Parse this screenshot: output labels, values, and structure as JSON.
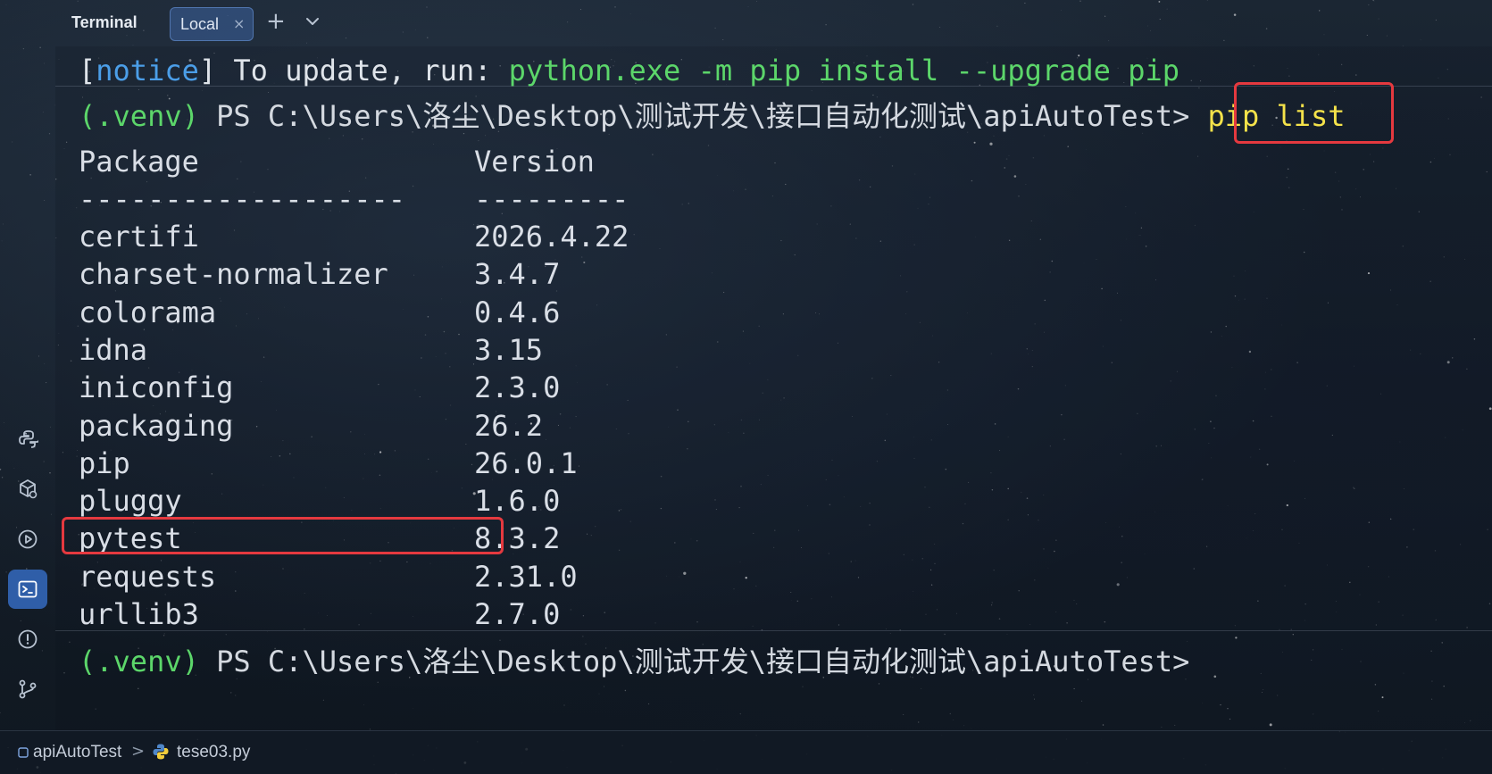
{
  "header": {
    "title": "Terminal",
    "tabs": [
      {
        "label": "Local",
        "close": "×"
      }
    ],
    "add_tab": "+"
  },
  "terminal": {
    "notice": {
      "bracket_open": "[",
      "tag": "notice",
      "bracket_close": "]",
      "text": " To update, run: ",
      "command": "python.exe -m pip install --upgrade pip"
    },
    "command_line": {
      "venv": "(.venv)",
      "prompt": " PS C:\\Users\\洛尘\\Desktop\\测试开发\\接口自动化测试\\apiAutoTest>",
      "command": "pip list"
    },
    "table": {
      "headers": {
        "package": "Package",
        "version": "Version"
      },
      "separators": {
        "package": "-------------------",
        "version": "---------"
      },
      "rows": [
        {
          "package": "certifi",
          "version": "2026.4.22"
        },
        {
          "package": "charset-normalizer",
          "version": "3.4.7"
        },
        {
          "package": "colorama",
          "version": "0.4.6"
        },
        {
          "package": "idna",
          "version": "3.15"
        },
        {
          "package": "iniconfig",
          "version": "2.3.0"
        },
        {
          "package": "packaging",
          "version": "26.2"
        },
        {
          "package": "pip",
          "version": "26.0.1"
        },
        {
          "package": "pluggy",
          "version": "1.6.0"
        },
        {
          "package": "pytest",
          "version": "8.3.2"
        },
        {
          "package": "requests",
          "version": "2.31.0"
        },
        {
          "package": "urllib3",
          "version": "2.7.0"
        }
      ]
    },
    "final_prompt": {
      "venv": "(.venv)",
      "prompt": " PS C:\\Users\\洛尘\\Desktop\\测试开发\\接口自动化测试\\apiAutoTest>"
    }
  },
  "statusbar": {
    "project": "apiAutoTest",
    "separator": ">",
    "file": "tese03.py"
  },
  "sidebar": {
    "icons": [
      "python-icon",
      "python-packages-icon",
      "run-icon",
      "terminal-icon",
      "problems-icon",
      "git-icon"
    ]
  },
  "colors": {
    "venv": "#5cd66a",
    "notice_tag": "#4b9ee8",
    "command": "#f4e24a",
    "highlight": "#e5393f",
    "active_rail": "#2f5ea8"
  }
}
